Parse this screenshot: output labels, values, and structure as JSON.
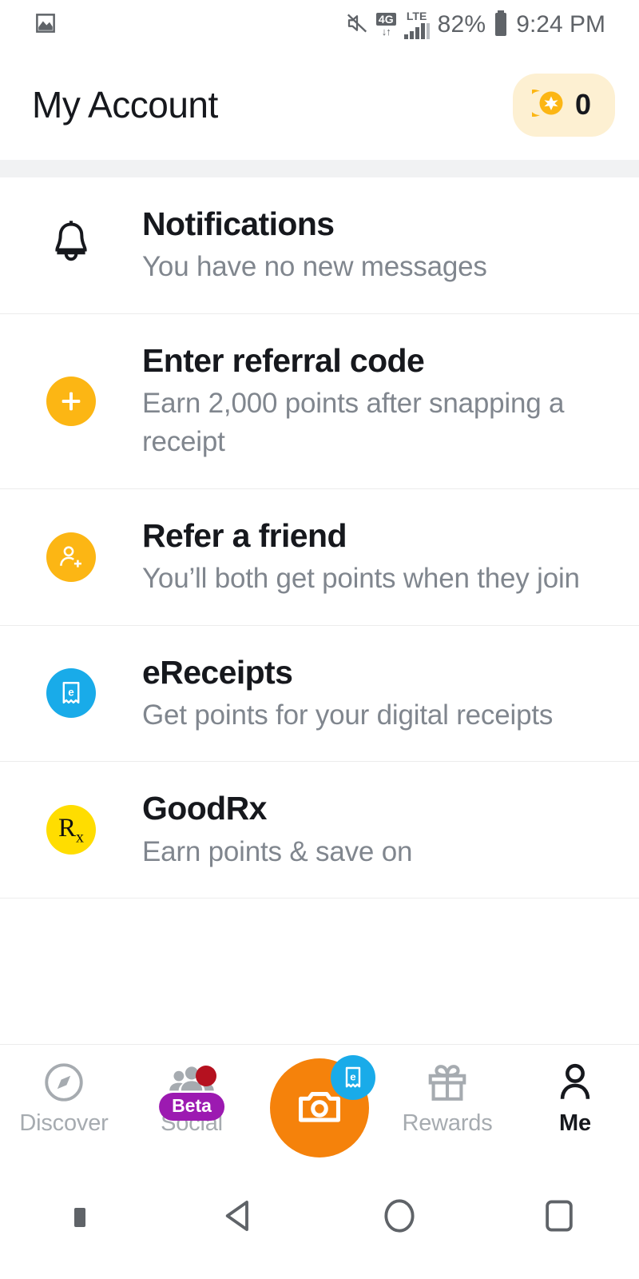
{
  "status_bar": {
    "left_icon": "image-icon",
    "mute_icon": "volume-mute-icon",
    "network_label": "4G",
    "network_arrows": "↓↑",
    "lte_label": "LTE",
    "signal_icon": "signal-bars-icon",
    "battery_percent": "82%",
    "battery_icon": "battery-icon",
    "time": "9:24 PM"
  },
  "header": {
    "title": "My Account",
    "points_icon": "coin-icon",
    "points_value": "0"
  },
  "menu": {
    "items": [
      {
        "name": "notifications",
        "icon": "bell-icon",
        "icon_style": "outline",
        "title": "Notifications",
        "subtitle": "You have no new messages"
      },
      {
        "name": "enter-referral-code",
        "icon": "plus-circle-icon",
        "icon_style": "amber",
        "title": "Enter referral code",
        "subtitle": "Earn 2,000 points after snapping a receipt"
      },
      {
        "name": "refer-a-friend",
        "icon": "person-add-icon",
        "icon_style": "amber",
        "title": "Refer a friend",
        "subtitle": "You’ll both get points when they join"
      },
      {
        "name": "ereceipts",
        "icon": "ereceipt-icon",
        "icon_style": "blue",
        "title": "eReceipts",
        "subtitle": "Get points for your digital receipts"
      },
      {
        "name": "goodrx",
        "icon": "rx-icon",
        "icon_style": "yellow",
        "title": "GoodRx",
        "subtitle": "Earn points & save on"
      }
    ]
  },
  "tab_bar": {
    "tabs": [
      {
        "name": "discover",
        "label": "Discover",
        "icon": "compass-icon",
        "active": false
      },
      {
        "name": "social",
        "label": "Social",
        "icon": "people-group-icon",
        "active": false,
        "badge_label": "Beta",
        "has_dot": true
      },
      {
        "name": "camera",
        "label": "",
        "icon": "camera-icon",
        "active": false,
        "badge_icon": "ereceipt-icon"
      },
      {
        "name": "rewards",
        "label": "Rewards",
        "icon": "gift-icon",
        "active": false
      },
      {
        "name": "me",
        "label": "Me",
        "icon": "person-icon",
        "active": true
      }
    ]
  },
  "android_nav": {
    "buttons": [
      {
        "name": "nav-dot",
        "icon": "dot-icon"
      },
      {
        "name": "nav-back",
        "icon": "back-triangle-icon"
      },
      {
        "name": "nav-home",
        "icon": "home-circle-icon"
      },
      {
        "name": "nav-recents",
        "icon": "recents-square-icon"
      }
    ]
  },
  "colors": {
    "amber": "#fcb614",
    "blue": "#19abe9",
    "yellow": "#ffdd00",
    "orange": "#f5820b",
    "purple": "#9c1ab1",
    "red": "#b5111f",
    "gray_text": "#80868e",
    "dark_text": "#16181d",
    "pill_bg": "#fdf0d2"
  }
}
